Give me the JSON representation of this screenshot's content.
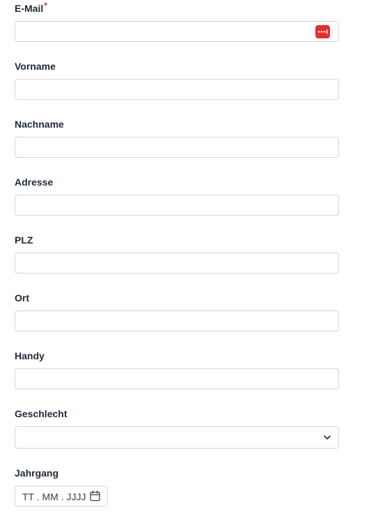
{
  "fields": {
    "email": {
      "label": "E-Mail",
      "required_mark": "*",
      "value": ""
    },
    "vorname": {
      "label": "Vorname",
      "value": ""
    },
    "nachname": {
      "label": "Nachname",
      "value": ""
    },
    "adresse": {
      "label": "Adresse",
      "value": ""
    },
    "plz": {
      "label": "PLZ",
      "value": ""
    },
    "ort": {
      "label": "Ort",
      "value": ""
    },
    "handy": {
      "label": "Handy",
      "value": ""
    },
    "geschlecht": {
      "label": "Geschlecht",
      "selected": ""
    },
    "jahrgang": {
      "label": "Jahrgang",
      "placeholder": "TT . MM . JJJJ"
    }
  },
  "icons": {
    "password_manager": "password-manager-icon",
    "dropdown": "chevron-down-icon",
    "calendar": "calendar-icon"
  },
  "colors": {
    "required": "#dc2626",
    "password_manager_bg": "#e03131",
    "border": "#d1d5db",
    "label": "#1f2937"
  }
}
